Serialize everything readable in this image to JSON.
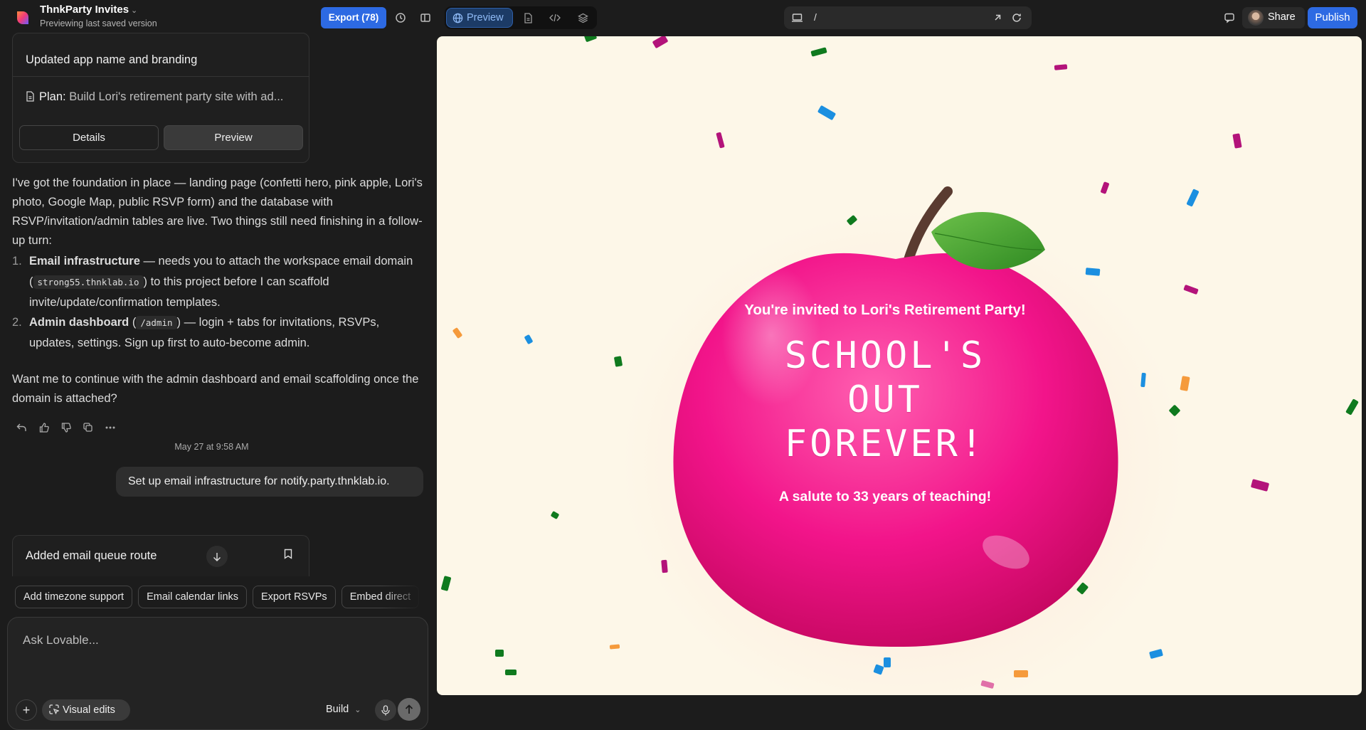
{
  "app": {
    "project_name": "ThnkParty Invites",
    "project_subtitle": "Previewing last saved version",
    "export_label": "Export (78)",
    "view_mode_label": "Preview",
    "url_path": "/",
    "share_label": "Share",
    "publish_label": "Publish",
    "colors": {
      "accent": "#2d6ae3",
      "apple_pink": "#f0208a",
      "leaf_green": "#4ea52e"
    }
  },
  "chat": {
    "card1": {
      "title": "Updated app name and branding",
      "plan_label": "Plan:",
      "plan_text": "Build Lori's retirement party site with ad...",
      "details_label": "Details",
      "preview_label": "Preview"
    },
    "assistant_intro": "I've got the foundation in place — landing page (confetti hero, pink apple, Lori's photo, Google Map, public RSVP form) and the database with RSVP/invitation/admin tables are live. Two things still need finishing in a follow-up turn:",
    "list": [
      {
        "num": "1.",
        "bold": "Email infrastructure",
        "pre": " — needs you to attach the workspace email domain (",
        "code": "strong55.thnklab.io",
        "post": ") to this project before I can scaffold invite/update/confirmation templates."
      },
      {
        "num": "2.",
        "bold": "Admin dashboard",
        "pre": " (",
        "code": "/admin",
        "post": ") — login + tabs for invitations, RSVPs, updates, settings. Sign up first to auto-become admin."
      }
    ],
    "assistant_outro": "Want me to continue with the admin dashboard and email scaffolding once the domain is attached?",
    "timestamp": "May 27 at 9:58 AM",
    "user_message": "Set up email infrastructure for notify.party.thnklab.io.",
    "card2_title": "Added email queue route",
    "suggestions": [
      "Add timezone support",
      "Email calendar links",
      "Export RSVPs",
      "Embed direct"
    ],
    "input_placeholder": "Ask Lovable...",
    "visual_edits_label": "Visual edits",
    "mode_label": "Build"
  },
  "preview": {
    "invite_line": "You're invited to Lori's Retirement Party!",
    "headline_lines": [
      "SCHOOL'S",
      "OUT",
      "FOREVER!"
    ],
    "salute_line": "A salute to 33 years of teaching!"
  }
}
